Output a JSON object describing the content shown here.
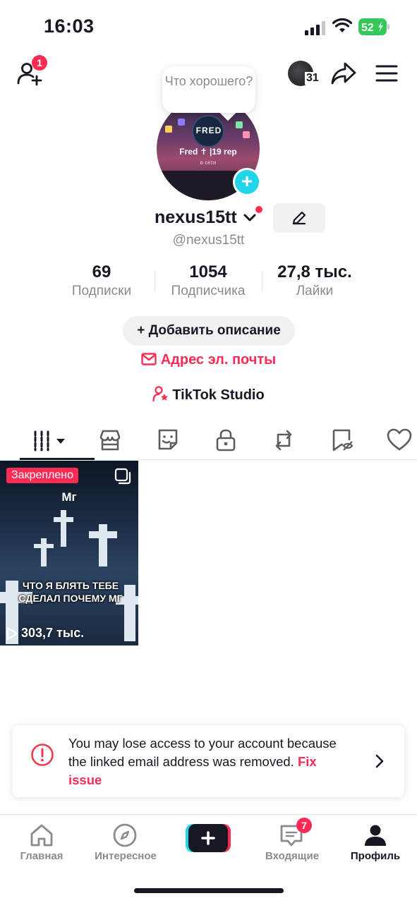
{
  "status_bar": {
    "time": "16:03",
    "battery": "52"
  },
  "header": {
    "friend_badge": "1",
    "inbox_count": "31"
  },
  "profile": {
    "bubble_text": "Что хорошего?",
    "avatar_name": "Fred ✝ |19 rep",
    "avatar_sub": "в сети",
    "avatar_logo": "FRED",
    "username": "nexus15tt",
    "handle": "@nexus15tt"
  },
  "stats": [
    {
      "value": "69",
      "label": "Подписки"
    },
    {
      "value": "1054",
      "label": "Подписчика"
    },
    {
      "value": "27,8 тыс.",
      "label": "Лайки"
    }
  ],
  "actions": {
    "add_description": "+ Добавить описание",
    "email": "Адрес эл. почты",
    "studio": "TikTok Studio"
  },
  "tabs": [
    "videos-icon",
    "shop-icon",
    "sticker-icon",
    "lock-icon",
    "repost-icon",
    "hidden-icon",
    "heart-icon"
  ],
  "video": {
    "pinned_label": "Закреплено",
    "title": "Мг",
    "caption": "ЧТО Я БЛЯТЬ ТЕБЕ СДЕЛАЛ ПОЧЕМУ МГ",
    "views": "303,7 тыс."
  },
  "banner": {
    "text": "You may lose access to your account because the linked email address was removed.",
    "link": "Fix issue"
  },
  "bottom_nav": {
    "home": "Главная",
    "explore": "Интересное",
    "inbox": "Входящие",
    "inbox_badge": "7",
    "profile": "Профиль"
  },
  "colors": {
    "accent": "#fe2c55",
    "cyan": "#20d5ec",
    "text": "#161823",
    "muted": "#8a8b91"
  }
}
